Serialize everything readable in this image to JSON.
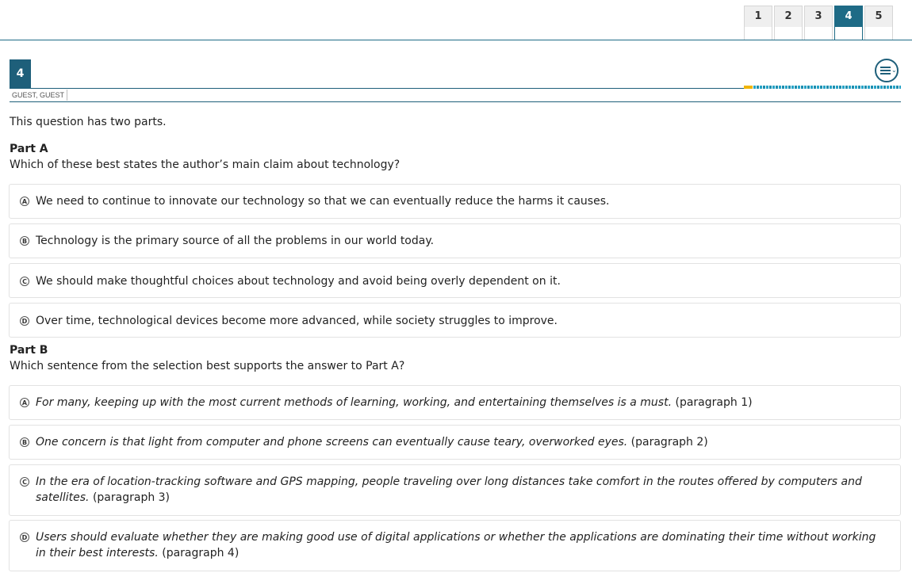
{
  "tabs": [
    {
      "label": "1",
      "active": false
    },
    {
      "label": "2",
      "active": false
    },
    {
      "label": "3",
      "active": false
    },
    {
      "label": "4",
      "active": true
    },
    {
      "label": "5",
      "active": false
    }
  ],
  "question": {
    "number": "4",
    "student": "GUEST, GUEST",
    "intro": "This question has two parts."
  },
  "partA": {
    "title": "Part A",
    "prompt": "Which of these best states the author’s main claim about technology?",
    "options": [
      {
        "letter": "A",
        "text": "We need to continue to innovate our technology so that we can eventually reduce the harms it causes."
      },
      {
        "letter": "B",
        "text": "Technology is the primary source of all the problems in our world today."
      },
      {
        "letter": "C",
        "text": "We should make thoughtful choices about technology and avoid being overly dependent on it."
      },
      {
        "letter": "D",
        "text": "Over time, technological devices become more advanced, while society struggles to improve."
      }
    ]
  },
  "partB": {
    "title": "Part B",
    "prompt": "Which sentence from the selection best supports the answer to Part A?",
    "options": [
      {
        "letter": "A",
        "quote": "For many, keeping up with the most current methods of learning, working, and entertaining themselves is a must.",
        "source": "(paragraph 1)"
      },
      {
        "letter": "B",
        "quote": "One concern is that light from computer and phone screens can eventually cause teary, overworked eyes.",
        "source": "(paragraph 2)"
      },
      {
        "letter": "C",
        "quote": "In the era of location-tracking software and GPS mapping, people traveling over long distances take comfort in the routes offered by computers and satellites.",
        "source": "(paragraph 3)"
      },
      {
        "letter": "D",
        "quote": "Users should evaluate whether they are making good use of digital applications or whether the applications are dominating their time without working in their best interests.",
        "source": "(paragraph 4)"
      }
    ]
  },
  "colors": {
    "accent": "#1e6b86",
    "progress_done": "#f0b400"
  },
  "icons": {
    "menu": "hamburger-menu-icon"
  }
}
